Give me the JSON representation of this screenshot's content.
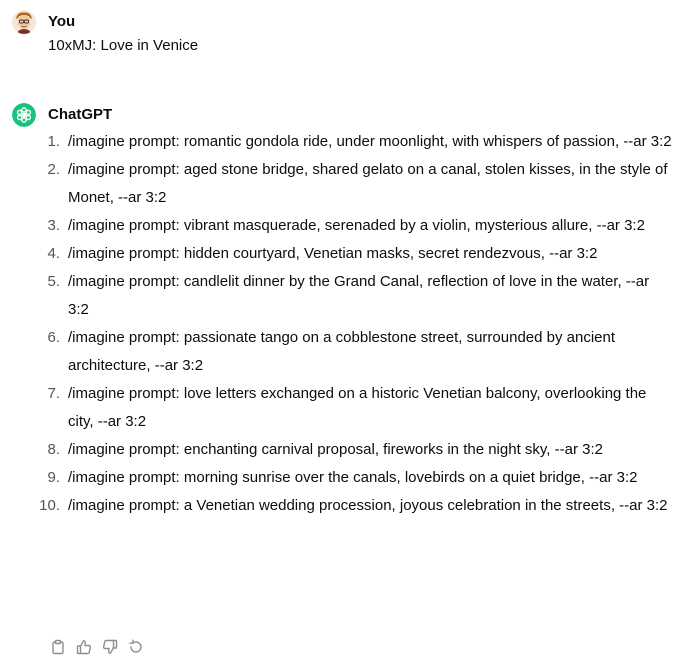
{
  "user": {
    "name": "You",
    "message": "10xMJ: Love in Venice"
  },
  "assistant": {
    "name": "ChatGPT",
    "accent_color": "#19c37d",
    "items": [
      {
        "number": "1.",
        "text": "/imagine prompt: romantic gondola ride, under moonlight, with whispers of passion, --ar 3:2"
      },
      {
        "number": "2.",
        "text": "/imagine prompt: aged stone bridge, shared gelato on a canal, stolen kisses, in the style of Monet, --ar 3:2"
      },
      {
        "number": "3.",
        "text": "/imagine prompt: vibrant masquerade, serenaded by a violin, mysterious allure, --ar 3:2"
      },
      {
        "number": "4.",
        "text": "/imagine prompt: hidden courtyard, Venetian masks, secret rendezvous, --ar 3:2"
      },
      {
        "number": "5.",
        "text": "/imagine prompt: candlelit dinner by the Grand Canal, reflection of love in the water, --ar 3:2"
      },
      {
        "number": "6.",
        "text": "/imagine prompt: passionate tango on a cobblestone street, surrounded by ancient architecture, --ar 3:2"
      },
      {
        "number": "7.",
        "text": "/imagine prompt: love letters exchanged on a historic Venetian balcony, overlooking the city, --ar 3:2"
      },
      {
        "number": "8.",
        "text": "/imagine prompt: enchanting carnival proposal, fireworks in the night sky, --ar 3:2"
      },
      {
        "number": "9.",
        "text": "/imagine prompt: morning sunrise over the canals, lovebirds on a quiet bridge, --ar 3:2"
      },
      {
        "number": "10.",
        "text": "/imagine prompt: a Venetian wedding procession, joyous celebration in the streets, --ar 3:2"
      }
    ],
    "actions": [
      "clipboard-icon",
      "thumbs-up-icon",
      "thumbs-down-icon",
      "regenerate-icon"
    ]
  }
}
